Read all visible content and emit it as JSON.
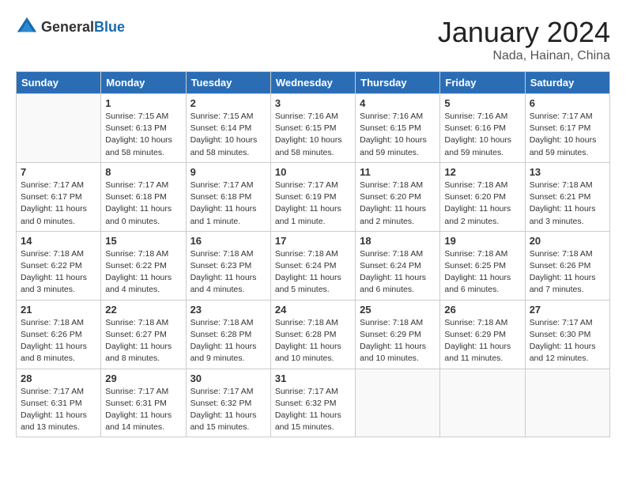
{
  "logo": {
    "general": "General",
    "blue": "Blue"
  },
  "header": {
    "month": "January 2024",
    "location": "Nada, Hainan, China"
  },
  "weekdays": [
    "Sunday",
    "Monday",
    "Tuesday",
    "Wednesday",
    "Thursday",
    "Friday",
    "Saturday"
  ],
  "weeks": [
    [
      {
        "day": "",
        "info": ""
      },
      {
        "day": "1",
        "info": "Sunrise: 7:15 AM\nSunset: 6:13 PM\nDaylight: 10 hours\nand 58 minutes."
      },
      {
        "day": "2",
        "info": "Sunrise: 7:15 AM\nSunset: 6:14 PM\nDaylight: 10 hours\nand 58 minutes."
      },
      {
        "day": "3",
        "info": "Sunrise: 7:16 AM\nSunset: 6:15 PM\nDaylight: 10 hours\nand 58 minutes."
      },
      {
        "day": "4",
        "info": "Sunrise: 7:16 AM\nSunset: 6:15 PM\nDaylight: 10 hours\nand 59 minutes."
      },
      {
        "day": "5",
        "info": "Sunrise: 7:16 AM\nSunset: 6:16 PM\nDaylight: 10 hours\nand 59 minutes."
      },
      {
        "day": "6",
        "info": "Sunrise: 7:17 AM\nSunset: 6:17 PM\nDaylight: 10 hours\nand 59 minutes."
      }
    ],
    [
      {
        "day": "7",
        "info": "Sunrise: 7:17 AM\nSunset: 6:17 PM\nDaylight: 11 hours\nand 0 minutes."
      },
      {
        "day": "8",
        "info": "Sunrise: 7:17 AM\nSunset: 6:18 PM\nDaylight: 11 hours\nand 0 minutes."
      },
      {
        "day": "9",
        "info": "Sunrise: 7:17 AM\nSunset: 6:18 PM\nDaylight: 11 hours\nand 1 minute."
      },
      {
        "day": "10",
        "info": "Sunrise: 7:17 AM\nSunset: 6:19 PM\nDaylight: 11 hours\nand 1 minute."
      },
      {
        "day": "11",
        "info": "Sunrise: 7:18 AM\nSunset: 6:20 PM\nDaylight: 11 hours\nand 2 minutes."
      },
      {
        "day": "12",
        "info": "Sunrise: 7:18 AM\nSunset: 6:20 PM\nDaylight: 11 hours\nand 2 minutes."
      },
      {
        "day": "13",
        "info": "Sunrise: 7:18 AM\nSunset: 6:21 PM\nDaylight: 11 hours\nand 3 minutes."
      }
    ],
    [
      {
        "day": "14",
        "info": "Sunrise: 7:18 AM\nSunset: 6:22 PM\nDaylight: 11 hours\nand 3 minutes."
      },
      {
        "day": "15",
        "info": "Sunrise: 7:18 AM\nSunset: 6:22 PM\nDaylight: 11 hours\nand 4 minutes."
      },
      {
        "day": "16",
        "info": "Sunrise: 7:18 AM\nSunset: 6:23 PM\nDaylight: 11 hours\nand 4 minutes."
      },
      {
        "day": "17",
        "info": "Sunrise: 7:18 AM\nSunset: 6:24 PM\nDaylight: 11 hours\nand 5 minutes."
      },
      {
        "day": "18",
        "info": "Sunrise: 7:18 AM\nSunset: 6:24 PM\nDaylight: 11 hours\nand 6 minutes."
      },
      {
        "day": "19",
        "info": "Sunrise: 7:18 AM\nSunset: 6:25 PM\nDaylight: 11 hours\nand 6 minutes."
      },
      {
        "day": "20",
        "info": "Sunrise: 7:18 AM\nSunset: 6:26 PM\nDaylight: 11 hours\nand 7 minutes."
      }
    ],
    [
      {
        "day": "21",
        "info": "Sunrise: 7:18 AM\nSunset: 6:26 PM\nDaylight: 11 hours\nand 8 minutes."
      },
      {
        "day": "22",
        "info": "Sunrise: 7:18 AM\nSunset: 6:27 PM\nDaylight: 11 hours\nand 8 minutes."
      },
      {
        "day": "23",
        "info": "Sunrise: 7:18 AM\nSunset: 6:28 PM\nDaylight: 11 hours\nand 9 minutes."
      },
      {
        "day": "24",
        "info": "Sunrise: 7:18 AM\nSunset: 6:28 PM\nDaylight: 11 hours\nand 10 minutes."
      },
      {
        "day": "25",
        "info": "Sunrise: 7:18 AM\nSunset: 6:29 PM\nDaylight: 11 hours\nand 10 minutes."
      },
      {
        "day": "26",
        "info": "Sunrise: 7:18 AM\nSunset: 6:29 PM\nDaylight: 11 hours\nand 11 minutes."
      },
      {
        "day": "27",
        "info": "Sunrise: 7:17 AM\nSunset: 6:30 PM\nDaylight: 11 hours\nand 12 minutes."
      }
    ],
    [
      {
        "day": "28",
        "info": "Sunrise: 7:17 AM\nSunset: 6:31 PM\nDaylight: 11 hours\nand 13 minutes."
      },
      {
        "day": "29",
        "info": "Sunrise: 7:17 AM\nSunset: 6:31 PM\nDaylight: 11 hours\nand 14 minutes."
      },
      {
        "day": "30",
        "info": "Sunrise: 7:17 AM\nSunset: 6:32 PM\nDaylight: 11 hours\nand 15 minutes."
      },
      {
        "day": "31",
        "info": "Sunrise: 7:17 AM\nSunset: 6:32 PM\nDaylight: 11 hours\nand 15 minutes."
      },
      {
        "day": "",
        "info": ""
      },
      {
        "day": "",
        "info": ""
      },
      {
        "day": "",
        "info": ""
      }
    ]
  ]
}
